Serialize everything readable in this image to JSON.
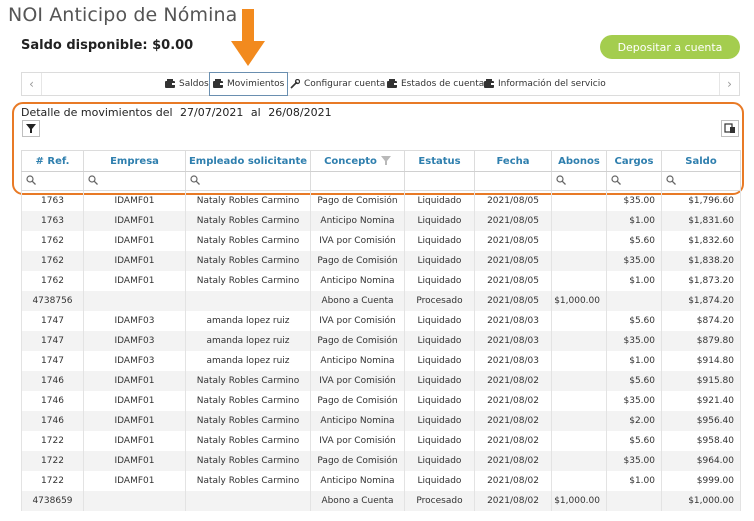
{
  "app": {
    "title": "NOI Anticipo de Nómina"
  },
  "balance": {
    "text": "Saldo disponible: $0.00"
  },
  "actions": {
    "deposit_label": "Depositar a cuenta"
  },
  "tabs": [
    {
      "label": "Saldos",
      "icon": "wallet-icon",
      "active": false
    },
    {
      "label": "Movimientos",
      "icon": "wallet-icon",
      "active": true
    },
    {
      "label": "Configurar cuenta",
      "icon": "wrench-icon",
      "active": false
    },
    {
      "label": "Estados de cuenta",
      "icon": "wallet-icon",
      "active": false
    },
    {
      "label": "Información del servicio",
      "icon": "wallet-icon",
      "active": false
    }
  ],
  "detail": {
    "prefix": "Detalle de movimientos del",
    "from": "27/07/2021",
    "connector": "al",
    "to": "26/08/2021"
  },
  "colors": {
    "accent": "#a4cd4e",
    "highlight": "#e87a26",
    "header_text": "#2f7fae"
  },
  "table": {
    "columns": [
      "# Ref.",
      "Empresa",
      "Empleado solicitante",
      "Concepto",
      "Estatus",
      "Fecha",
      "Abonos",
      "Cargos",
      "Saldo"
    ],
    "rows": [
      [
        "1763",
        "IDAMF01",
        "Nataly Robles Carmino",
        "Pago de Comisión",
        "Liquidado",
        "2021/08/05",
        "",
        "$35.00",
        "$1,796.60"
      ],
      [
        "1763",
        "IDAMF01",
        "Nataly Robles Carmino",
        "Anticipo Nomina",
        "Liquidado",
        "2021/08/05",
        "",
        "$1.00",
        "$1,831.60"
      ],
      [
        "1762",
        "IDAMF01",
        "Nataly Robles Carmino",
        "IVA por Comisión",
        "Liquidado",
        "2021/08/05",
        "",
        "$5.60",
        "$1,832.60"
      ],
      [
        "1762",
        "IDAMF01",
        "Nataly Robles Carmino",
        "Pago de Comisión",
        "Liquidado",
        "2021/08/05",
        "",
        "$35.00",
        "$1,838.20"
      ],
      [
        "1762",
        "IDAMF01",
        "Nataly Robles Carmino",
        "Anticipo Nomina",
        "Liquidado",
        "2021/08/05",
        "",
        "$1.00",
        "$1,873.20"
      ],
      [
        "4738756",
        "",
        "",
        "Abono a Cuenta",
        "Procesado",
        "2021/08/05",
        "$1,000.00",
        "",
        "$1,874.20"
      ],
      [
        "1747",
        "IDAMF03",
        "amanda lopez ruiz",
        "IVA por Comisión",
        "Liquidado",
        "2021/08/03",
        "",
        "$5.60",
        "$874.20"
      ],
      [
        "1747",
        "IDAMF03",
        "amanda lopez ruiz",
        "Pago de Comisión",
        "Liquidado",
        "2021/08/03",
        "",
        "$35.00",
        "$879.80"
      ],
      [
        "1747",
        "IDAMF03",
        "amanda lopez ruiz",
        "Anticipo Nomina",
        "Liquidado",
        "2021/08/03",
        "",
        "$1.00",
        "$914.80"
      ],
      [
        "1746",
        "IDAMF01",
        "Nataly Robles Carmino",
        "IVA por Comisión",
        "Liquidado",
        "2021/08/02",
        "",
        "$5.60",
        "$915.80"
      ],
      [
        "1746",
        "IDAMF01",
        "Nataly Robles Carmino",
        "Pago de Comisión",
        "Liquidado",
        "2021/08/02",
        "",
        "$35.00",
        "$921.40"
      ],
      [
        "1746",
        "IDAMF01",
        "Nataly Robles Carmino",
        "Anticipo Nomina",
        "Liquidado",
        "2021/08/02",
        "",
        "$2.00",
        "$956.40"
      ],
      [
        "1722",
        "IDAMF01",
        "Nataly Robles Carmino",
        "IVA por Comisión",
        "Liquidado",
        "2021/08/02",
        "",
        "$5.60",
        "$958.40"
      ],
      [
        "1722",
        "IDAMF01",
        "Nataly Robles Carmino",
        "Pago de Comisión",
        "Liquidado",
        "2021/08/02",
        "",
        "$35.00",
        "$964.00"
      ],
      [
        "1722",
        "IDAMF01",
        "Nataly Robles Carmino",
        "Anticipo Nomina",
        "Liquidado",
        "2021/08/02",
        "",
        "$1.00",
        "$999.00"
      ],
      [
        "4738659",
        "",
        "",
        "Abono a Cuenta",
        "Procesado",
        "2021/08/02",
        "$1,000.00",
        "",
        "$1,000.00"
      ]
    ]
  }
}
